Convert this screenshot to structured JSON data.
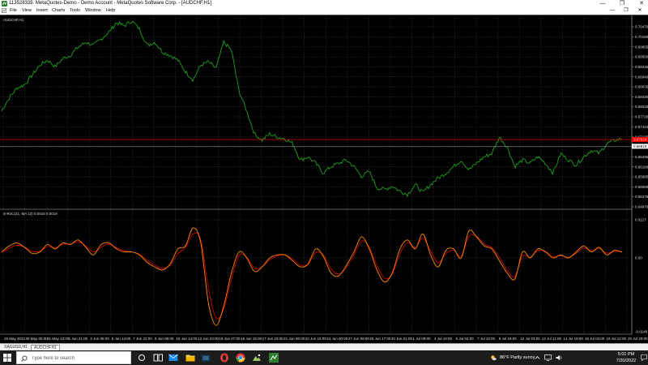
{
  "window": {
    "title": "113528335: MetaQuotes-Demo - Demo Account - MetaQuotes Software Corp. - [AUDCHF,H1]",
    "minimize_glyph": "—",
    "restore_glyph": "❐",
    "close_glyph": "✕"
  },
  "menubar": {
    "items": [
      "File",
      "View",
      "Insert",
      "Charts",
      "Tools",
      "Window",
      "Help"
    ],
    "mdi_minimize": "—",
    "mdi_restore": "❐",
    "mdi_close": "✕"
  },
  "colors": {
    "price_line": "#1fa01f",
    "grid": "#4a4a4a",
    "ask_line": "#ff0000",
    "bid_line": "#9a9a9a",
    "indicator_main": "#ff8c00",
    "indicator_signal": "#c80000"
  },
  "chart_data": [
    {
      "type": "line",
      "title": "AUDCHF,H1",
      "series": [
        {
          "y": [
            0.679,
            0.683,
            0.686,
            0.687,
            0.69,
            0.693,
            0.6945,
            0.6925,
            0.695,
            0.696,
            0.6985,
            0.7,
            0.699,
            0.701,
            0.703,
            0.706,
            0.705,
            0.7065,
            0.704,
            0.699,
            0.7,
            0.697,
            0.696,
            0.6945,
            0.691,
            0.6885,
            0.693,
            0.694,
            0.692,
            0.7,
            0.6975,
            0.685,
            0.679,
            0.672,
            0.67,
            0.672,
            0.671,
            0.6705,
            0.669,
            0.664,
            0.665,
            0.663,
            0.66,
            0.662,
            0.663,
            0.664,
            0.662,
            0.659,
            0.6605,
            0.6555,
            0.655,
            0.656,
            0.6545,
            0.6535,
            0.6565,
            0.654,
            0.6565,
            0.6585,
            0.66,
            0.662,
            0.664,
            0.661,
            0.663,
            0.665,
            0.666,
            0.671,
            0.668,
            0.662,
            0.664,
            0.663,
            0.665,
            0.663,
            0.66,
            0.666,
            0.664,
            0.6625,
            0.665,
            0.667,
            0.666,
            0.669,
            0.67,
            0.6705
          ]
        }
      ],
      "y_ticks": [
        "0.70470",
        "0.70160",
        "0.69855",
        "0.69550",
        "0.69245",
        "0.68940",
        "0.68635",
        "0.68330",
        "0.68025",
        "0.67720",
        "0.67410",
        "0.67105",
        "0.66800",
        "0.66495",
        "0.66190",
        "0.65885",
        "0.65580",
        "0.65275",
        "0.64970"
      ],
      "ylim": [
        0.6497,
        0.7047
      ],
      "ask_label": "0.67024",
      "bid_label": "0.66819",
      "ask_value": 0.67024,
      "bid_value": 0.66819,
      "x_ticks": [
        "26 May 2022",
        "30 May 05:00",
        "31 May 13:00",
        "1 Jun 21:00",
        "3 Jun 05:00",
        "6 Jun 14:00",
        "7 Jun 22:00",
        "9 Jun 06:00",
        "10 Jun 14:00",
        "13 Jun 23:00",
        "15 Jun 07:00",
        "16 Jun 15:00",
        "17 Jun 23:00",
        "21 Jun 08:00",
        "22 Jun 16:00",
        "24 Jun 00:00",
        "27 Jun 09:00",
        "28 Jun 17:00",
        "30 Jun 01:00",
        "1 Jul 09:00",
        "4 Jul 18:00",
        "6 Jul 02:00",
        "7 Jul 10:00",
        "8 Jul 18:00",
        "12 Jul 03:00",
        "13 Jul 11:00",
        "14 Jul 19:00",
        "18 Jul 04:00",
        "19 Jul 12:00",
        "20 Jul 20:00"
      ]
    },
    {
      "type": "line",
      "title": "S-RoC(21, MA 13) 0.0015 0.0019",
      "series": [
        {
          "name": "main",
          "y": [
            0.002,
            0.004,
            0.005,
            0.0035,
            0.0015,
            0.002,
            0.0045,
            0.003,
            0.005,
            0.0045,
            0.006,
            0.0035,
            0.001,
            0.0045,
            0.005,
            0.003,
            0.002,
            0.002,
            0.001,
            -0.0015,
            -0.003,
            -0.004,
            -0.002,
            0.003,
            0.004,
            0.01,
            0.005,
            -0.015,
            -0.0225,
            -0.016,
            -0.005,
            0.002,
            0.0,
            -0.0045,
            -0.003,
            0.0,
            0.001,
            0.001,
            -0.001,
            -0.003,
            -0.002,
            0.003,
            0.0005,
            -0.005,
            -0.006,
            -0.0025,
            0.002,
            0.007,
            0.003,
            -0.004,
            -0.008,
            -0.005,
            0.003,
            0.006,
            0.003,
            0.008,
            0.001,
            -0.003,
            0.0025,
            0.003,
            0.0,
            0.009,
            0.007,
            0.004,
            0.003,
            -0.001,
            -0.005,
            -0.007,
            0.002,
            0.0,
            0.003,
            0.002,
            0.0,
            0.001,
            0.0,
            0.002,
            0.004,
            0.002,
            0.0035,
            0.001,
            0.0025,
            0.002
          ]
        },
        {
          "name": "signal",
          "y": [
            0.0018,
            0.0032,
            0.0042,
            0.0036,
            0.0022,
            0.0022,
            0.0038,
            0.0034,
            0.0046,
            0.0046,
            0.0054,
            0.004,
            0.002,
            0.0036,
            0.0046,
            0.0034,
            0.0024,
            0.002,
            0.0012,
            -0.0008,
            -0.0024,
            -0.0034,
            -0.0024,
            0.0014,
            0.0034,
            0.008,
            0.006,
            -0.01,
            -0.02,
            -0.017,
            -0.007,
            0.0008,
            0.0002,
            -0.0034,
            -0.003,
            -0.0006,
            0.0006,
            0.001,
            -0.0004,
            -0.0024,
            -0.0022,
            0.0018,
            0.001,
            -0.0036,
            -0.0054,
            -0.0032,
            0.001,
            0.0056,
            0.0036,
            -0.0026,
            -0.0068,
            -0.0054,
            0.0014,
            0.005,
            0.0034,
            0.0066,
            0.0024,
            -0.0016,
            0.0014,
            0.0026,
            0.0006,
            0.0072,
            0.0072,
            0.0046,
            0.0034,
            0.0002,
            -0.004,
            -0.0062,
            0.0006,
            0.0002,
            0.0024,
            0.0022,
            0.0004,
            0.0008,
            0.0002,
            0.0016,
            0.0034,
            0.0024,
            0.0032,
            0.0016,
            0.0022,
            0.002
          ]
        }
      ],
      "y_ticks": [
        "0.0127",
        "0.00",
        "-0.0246"
      ],
      "ylim": [
        -0.0246,
        0.0127
      ]
    }
  ],
  "tabs": [
    "XAGUSD,H1",
    "AUDCHF,H1"
  ],
  "active_tab_index": 1,
  "taskbar": {
    "search_placeholder": "Type here to search",
    "weather": "86°F  Partly sunny",
    "time": "5:01 PM",
    "date": "7/20/2022"
  }
}
